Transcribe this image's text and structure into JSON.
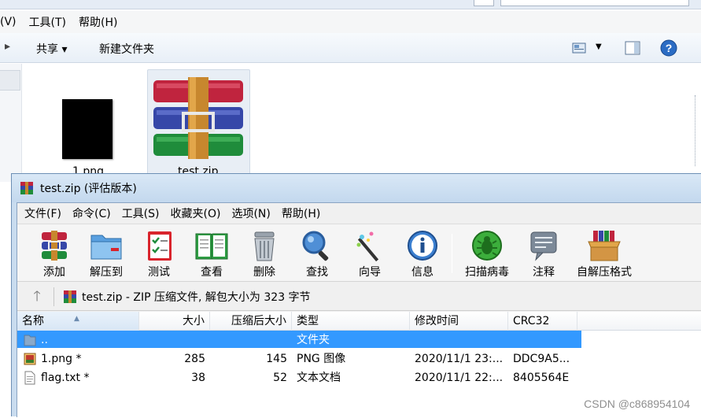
{
  "explorer": {
    "menu": [
      "(V)",
      "工具(T)",
      "帮助(H)"
    ],
    "commands": {
      "share": "共享 ▾",
      "new_folder": "新建文件夹"
    },
    "files": [
      {
        "name": "1.png",
        "type": "image"
      },
      {
        "name": "test.zip",
        "type": "winrar-archive"
      }
    ]
  },
  "rar": {
    "title": "test.zip (评估版本)",
    "menu": [
      "文件(F)",
      "命令(C)",
      "工具(S)",
      "收藏夹(O)",
      "选项(N)",
      "帮助(H)"
    ],
    "toolbar": [
      {
        "label": "添加",
        "icon": "add-archive-icon"
      },
      {
        "label": "解压到",
        "icon": "extract-to-folder-icon"
      },
      {
        "label": "测试",
        "icon": "test-checklist-icon"
      },
      {
        "label": "查看",
        "icon": "view-book-icon"
      },
      {
        "label": "删除",
        "icon": "delete-trash-icon"
      },
      {
        "label": "查找",
        "icon": "find-magnifier-icon"
      },
      {
        "label": "向导",
        "icon": "wizard-wand-icon"
      },
      {
        "label": "信息",
        "icon": "info-icon"
      },
      {
        "label": "扫描病毒",
        "icon": "virus-scan-bug-icon"
      },
      {
        "label": "注释",
        "icon": "comment-note-icon"
      },
      {
        "label": "自解压格式",
        "icon": "sfx-box-icon"
      }
    ],
    "path": "test.zip - ZIP 压缩文件, 解包大小为 323 字节",
    "columns": [
      "名称",
      "大小",
      "压缩后大小",
      "类型",
      "修改时间",
      "CRC32"
    ],
    "rows": [
      {
        "name": "..",
        "size": "",
        "packed": "",
        "type": "文件夹",
        "modified": "",
        "crc": ""
      },
      {
        "name": "1.png *",
        "size": "285",
        "packed": "145",
        "type": "PNG 图像",
        "modified": "2020/11/1 23:...",
        "crc": "DDC9A5..."
      },
      {
        "name": "flag.txt *",
        "size": "38",
        "packed": "52",
        "type": "文本文档",
        "modified": "2020/11/1 22:...",
        "crc": "8405564E"
      }
    ]
  },
  "watermark": "CSDN @c868954104",
  "colors": {
    "selection": "#3399ff",
    "title_bg": "#c9dcef"
  }
}
